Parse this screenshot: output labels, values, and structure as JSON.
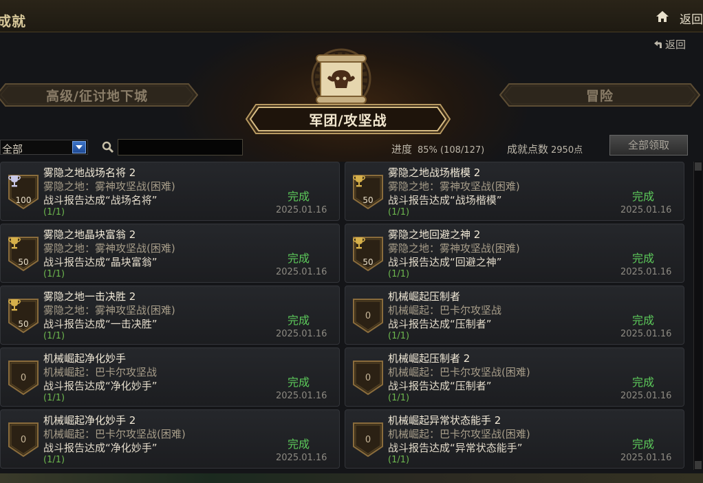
{
  "window": {
    "title": "成就",
    "back_label": "返回"
  },
  "sub_back_label": "返回",
  "tabs": {
    "left": "高级/征讨地下城",
    "center": "军团/攻坚战",
    "right": "冒险"
  },
  "filter": {
    "selected": "全部",
    "search_placeholder": "",
    "progress_label": "进度",
    "progress_value": "85% (108/127)",
    "points_label": "成就点数",
    "points_value": "2950点",
    "claim_all_label": "全部领取"
  },
  "colors": {
    "complete": "#5cc95a",
    "progress": "#6db84e",
    "gold": "#d6b04a",
    "silver": "#c8c8e8"
  },
  "achievements": [
    {
      "title": "雾隐之地战场名将 2",
      "line1": "雾隐之地：雾神攻坚战(困难)",
      "line2": "战斗报告达成“战场名将”",
      "progress": "(1/1)",
      "status": "完成",
      "date": "2025.01.16",
      "points": "100",
      "trophy": "silver"
    },
    {
      "title": "雾隐之地战场楷模 2",
      "line1": "雾隐之地：雾神攻坚战(困难)",
      "line2": "战斗报告达成“战场楷模”",
      "progress": "(1/1)",
      "status": "完成",
      "date": "2025.01.16",
      "points": "50",
      "trophy": "gold"
    },
    {
      "title": "雾隐之地晶块富翁 2",
      "line1": "雾隐之地：雾神攻坚战(困难)",
      "line2": "战斗报告达成“晶块富翁”",
      "progress": "(1/1)",
      "status": "完成",
      "date": "2025.01.16",
      "points": "50",
      "trophy": "gold"
    },
    {
      "title": "雾隐之地回避之神 2",
      "line1": "雾隐之地：雾神攻坚战(困难)",
      "line2": "战斗报告达成“回避之神”",
      "progress": "(1/1)",
      "status": "完成",
      "date": "2025.01.16",
      "points": "50",
      "trophy": "gold"
    },
    {
      "title": "雾隐之地一击决胜 2",
      "line1": "雾隐之地：雾神攻坚战(困难)",
      "line2": "战斗报告达成“一击决胜”",
      "progress": "(1/1)",
      "status": "完成",
      "date": "2025.01.16",
      "points": "50",
      "trophy": "gold"
    },
    {
      "title": "机械崛起压制者",
      "line1": "机械崛起：巴卡尔攻坚战",
      "line2": "战斗报告达成“压制者”",
      "progress": "(1/1)",
      "status": "完成",
      "date": "2025.01.16",
      "points": "0",
      "trophy": "none"
    },
    {
      "title": "机械崛起净化妙手",
      "line1": "机械崛起：巴卡尔攻坚战",
      "line2": "战斗报告达成“净化妙手”",
      "progress": "(1/1)",
      "status": "完成",
      "date": "2025.01.16",
      "points": "0",
      "trophy": "none"
    },
    {
      "title": "机械崛起压制者 2",
      "line1": "机械崛起：巴卡尔攻坚战(困难)",
      "line2": "战斗报告达成“压制者”",
      "progress": "(1/1)",
      "status": "完成",
      "date": "2025.01.16",
      "points": "0",
      "trophy": "none"
    },
    {
      "title": "机械崛起净化妙手 2",
      "line1": "机械崛起：巴卡尔攻坚战(困难)",
      "line2": "战斗报告达成“净化妙手”",
      "progress": "(1/1)",
      "status": "完成",
      "date": "2025.01.16",
      "points": "0",
      "trophy": "none"
    },
    {
      "title": "机械崛起异常状态能手 2",
      "line1": "机械崛起：巴卡尔攻坚战(困难)",
      "line2": "战斗报告达成“异常状态能手”",
      "progress": "(1/1)",
      "status": "完成",
      "date": "2025.01.16",
      "points": "0",
      "trophy": "none"
    }
  ]
}
